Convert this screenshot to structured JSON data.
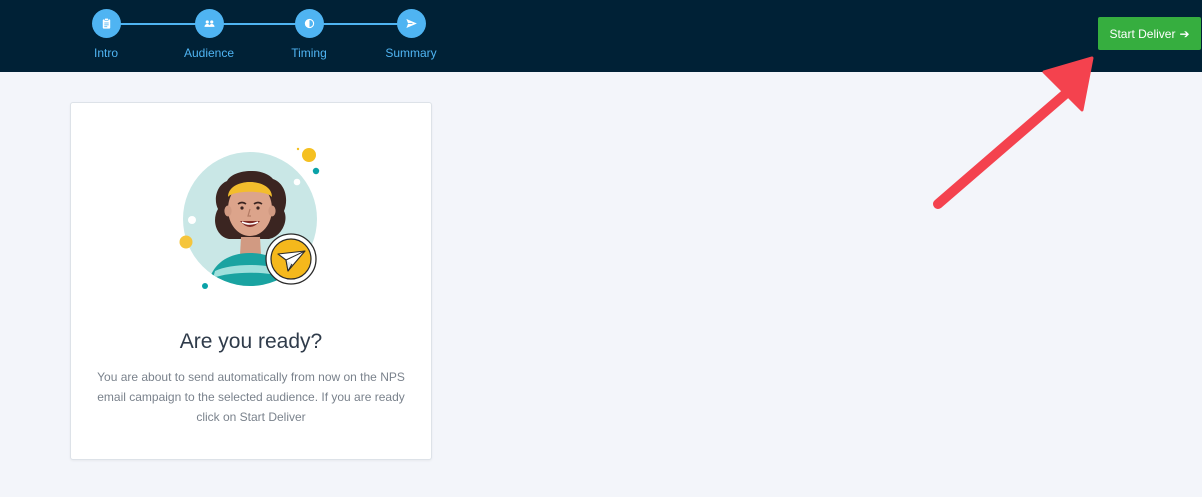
{
  "header": {
    "steps": [
      {
        "label": "Intro",
        "icon": "clipboard-icon"
      },
      {
        "label": "Audience",
        "icon": "users-icon"
      },
      {
        "label": "Timing",
        "icon": "timer-icon"
      },
      {
        "label": "Summary",
        "icon": "send-icon"
      }
    ],
    "start_button": {
      "label": "Start Deliver",
      "icon": "arrow-right-icon"
    }
  },
  "card": {
    "title": "Are you ready?",
    "description": "You are about to send automatically from now on the NPS email campaign to the selected audience. If you are ready click on Start Deliver"
  },
  "colors": {
    "topbar": "#002136",
    "step_accent": "#4fb4f2",
    "button": "#36ae3f",
    "annotation_arrow": "#f4424e",
    "background": "#f3f5fa"
  }
}
